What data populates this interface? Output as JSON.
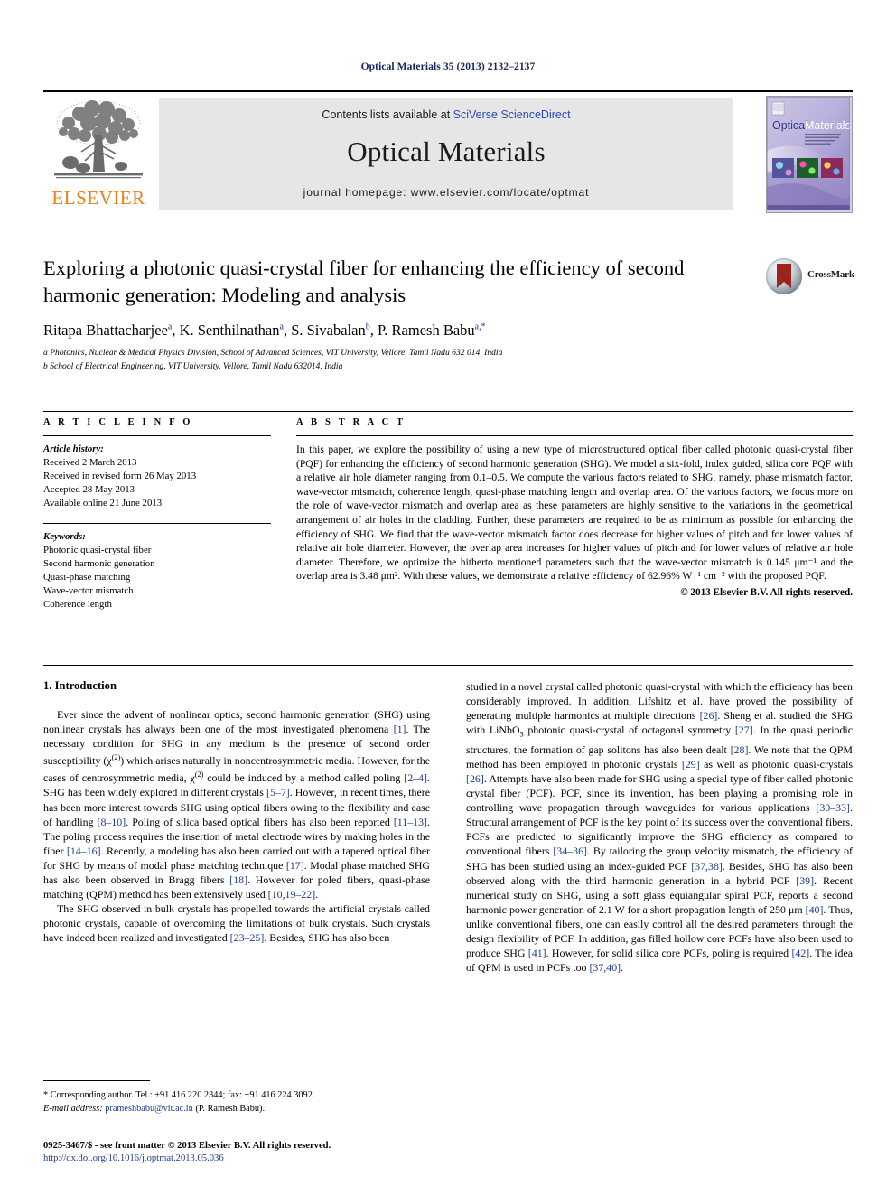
{
  "running_head": "Optical Materials 35 (2013) 2132–2137",
  "masthead": {
    "publisher_name": "ELSEVIER",
    "contents_prefix": "Contents lists available at ",
    "contents_link": "SciVerse ScienceDirect",
    "journal_title": "Optical Materials",
    "homepage": "journal homepage: www.elsevier.com/locate/optmat",
    "cover_title_a": "Optical",
    "cover_title_b": "Materials"
  },
  "article": {
    "title": "Exploring a photonic quasi-crystal fiber for enhancing the efficiency of second harmonic generation: Modeling and analysis",
    "authors": "Ritapa Bhattacharjee a, K. Senthilnathan a, S. Sivabalan b, P. Ramesh Babu a,*",
    "affiliation_a": "a Photonics, Nuclear & Medical Physics Division, School of Advanced Sciences, VIT University, Vellore, Tamil Nadu 632 014, India",
    "affiliation_b": "b School of Electrical Engineering, VIT University, Vellore, Tamil Nadu 632014, India",
    "crossmark_label": "CrossMark"
  },
  "info": {
    "heading": "A R T I C L E    I N F O",
    "history_label": "Article history:",
    "history": [
      "Received 2 March 2013",
      "Received in revised form 26 May 2013",
      "Accepted 28 May 2013",
      "Available online 21 June 2013"
    ],
    "keywords_label": "Keywords:",
    "keywords": [
      "Photonic quasi-crystal fiber",
      "Second harmonic generation",
      "Quasi-phase matching",
      "Wave-vector mismatch",
      "Coherence length"
    ]
  },
  "abstract": {
    "heading": "A B S T R A C T",
    "text": "In this paper, we explore the possibility of using a new type of microstructured optical fiber called photonic quasi-crystal fiber (PQF) for enhancing the efficiency of second harmonic generation (SHG). We model a six-fold, index guided, silica core PQF with a relative air hole diameter ranging from 0.1–0.5. We compute the various factors related to SHG, namely, phase mismatch factor, wave-vector mismatch, coherence length, quasi-phase matching length and overlap area. Of the various factors, we focus more on the role of wave-vector mismatch and overlap area as these parameters are highly sensitive to the variations in the geometrical arrangement of air holes in the cladding. Further, these parameters are required to be as minimum as possible for enhancing the efficiency of SHG. We find that the wave-vector mismatch factor does decrease for higher values of pitch and for lower values of relative air hole diameter. However, the overlap area increases for higher values of pitch and for lower values of relative air hole diameter. Therefore, we optimize the hitherto mentioned parameters such that the wave-vector mismatch is 0.145 μm⁻¹ and the overlap area is 3.48 μm². With these values, we demonstrate a relative efficiency of 62.96% W⁻¹ cm⁻² with the proposed PQF.",
    "copyright": "© 2013 Elsevier B.V. All rights reserved."
  },
  "body": {
    "section_heading": "1. Introduction",
    "left_paragraphs": [
      "Ever since the advent of nonlinear optics, second harmonic generation (SHG) using nonlinear crystals has always been one of the most investigated phenomena [1]. The necessary condition for SHG in any medium is the presence of second order susceptibility (χ(2)) which arises naturally in noncentrosymmetric media. However, for the cases of centrosymmetric media, χ(2) could be induced by a method called poling [2–4]. SHG has been widely explored in different crystals [5–7]. However, in recent times, there has been more interest towards SHG using optical fibers owing to the flexibility and ease of handling [8–10]. Poling of silica based optical fibers has also been reported [11–13]. The poling process requires the insertion of metal electrode wires by making holes in the fiber [14–16]. Recently, a modeling has also been carried out with a tapered optical fiber for SHG by means of modal phase matching technique [17]. Modal phase matched SHG has also been observed in Bragg fibers [18]. However for poled fibers, quasi-phase matching (QPM) method has been extensively used [10,19–22].",
      "The SHG observed in bulk crystals has propelled towards the artificial crystals called photonic crystals, capable of overcoming the limitations of bulk crystals. Such crystals have indeed been realized and investigated [23–25]. Besides, SHG has also been"
    ],
    "right_paragraphs": [
      "studied in a novel crystal called photonic quasi-crystal with which the efficiency has been considerably improved. In addition, Lifshitz et al. have proved the possibility of generating multiple harmonics at multiple directions [26]. Sheng et al. studied the SHG with LiNbO3 photonic quasi-crystal of octagonal symmetry [27]. In the quasi periodic structures, the formation of gap solitons has also been dealt [28]. We note that the QPM method has been employed in photonic crystals [29] as well as photonic quasi-crystals [26]. Attempts have also been made for SHG using a special type of fiber called photonic crystal fiber (PCF). PCF, since its invention, has been playing a promising role in controlling wave propagation through waveguides for various applications [30–33]. Structural arrangement of PCF is the key point of its success over the conventional fibers. PCFs are predicted to significantly improve the SHG efficiency as compared to conventional fibers [34–36]. By tailoring the group velocity mismatch, the efficiency of SHG has been studied using an index-guided PCF [37,38]. Besides, SHG has also been observed along with the third harmonic generation in a hybrid PCF [39]. Recent numerical study on SHG, using a soft glass equiangular spiral PCF, reports a second harmonic power generation of 2.1 W for a short propagation length of 250 μm [40]. Thus, unlike conventional fibers, one can easily control all the desired parameters through the design flexibility of PCF. In addition, gas filled hollow core PCFs have also been used to produce SHG [41]. However, for solid silica core PCFs, poling is required [42]. The idea of QPM is used in PCFs too [37,40]."
    ]
  },
  "footnote": {
    "corresponding": "* Corresponding author. Tel.: +91 416 220 2344; fax: +91 416 224 3092.",
    "email_label": "E-mail address:",
    "email": "prameshbabu@vit.ac.in",
    "email_owner": "(P. Ramesh Babu)."
  },
  "footer": {
    "issn_line": "0925-3467/$ - see front matter © 2013 Elsevier B.V. All rights reserved.",
    "doi_line": "http://dx.doi.org/10.1016/j.optmat.2013.05.036"
  },
  "colors": {
    "link": "#1d3c8c",
    "running_head": "#16255c",
    "elsevier_orange": "#f07f13",
    "band_gray": "#e6e6e6"
  }
}
